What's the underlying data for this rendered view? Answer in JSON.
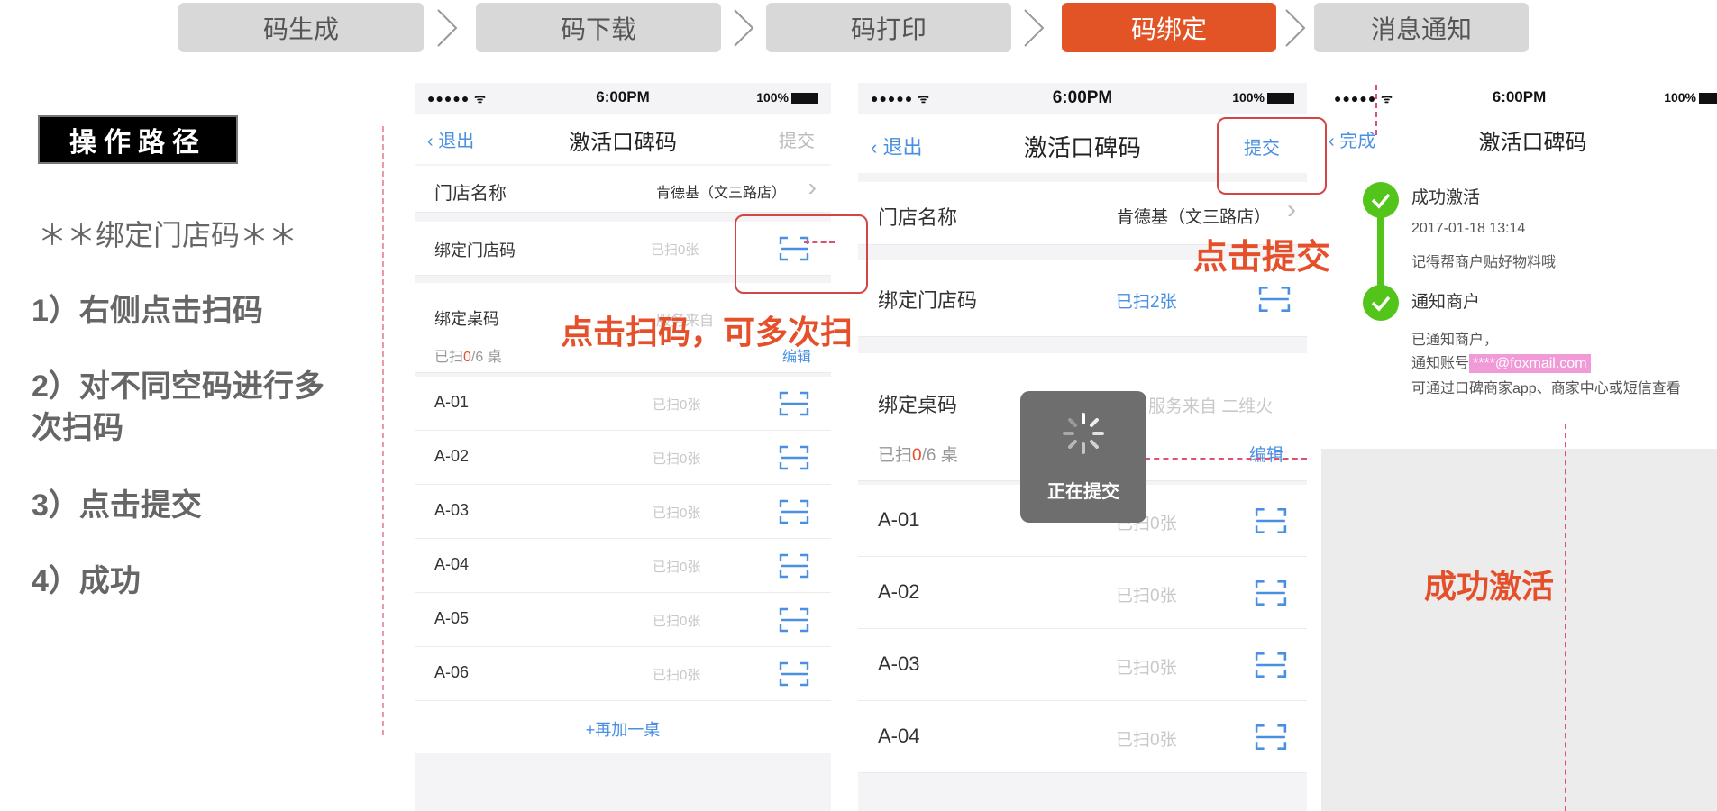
{
  "steps": [
    {
      "label": "码生成",
      "active": false
    },
    {
      "label": "码下载",
      "active": false
    },
    {
      "label": "码打印",
      "active": false
    },
    {
      "label": "码绑定",
      "active": true
    },
    {
      "label": "消息通知",
      "active": false
    }
  ],
  "instructions": {
    "path_title": "操作路径",
    "subtitle": "＊＊绑定门店码＊＊",
    "step1": "1）右侧点击扫码",
    "step2": "2）对不同空码进行多次扫码",
    "step3": "3）点击提交",
    "step4": "4）成功"
  },
  "status_bar": {
    "signal": "●●●●● ᯤ",
    "time": "6:00PM",
    "battery": "100%"
  },
  "phone1": {
    "back": "退出",
    "title": "激活口碑码",
    "submit": "提交",
    "store_label": "门店名称",
    "store_value": "肯德基（文三路店）",
    "bind_store_label": "绑定门店码",
    "bind_store_value": "已扫0张",
    "bind_table_label": "绑定桌码",
    "bind_table_hint": "服务来自",
    "scanned_prefix": "已扫",
    "scanned_count": "0",
    "scanned_suffix": "/6 桌",
    "edit": "编辑",
    "tables": [
      {
        "name": "A-01",
        "value": "已扫0张"
      },
      {
        "name": "A-02",
        "value": "已扫0张"
      },
      {
        "name": "A-03",
        "value": "已扫0张"
      },
      {
        "name": "A-04",
        "value": "已扫0张"
      },
      {
        "name": "A-05",
        "value": "已扫0张"
      },
      {
        "name": "A-06",
        "value": "已扫0张"
      }
    ],
    "add_table": "+再加一桌"
  },
  "phone2": {
    "back": "退出",
    "title": "激活口碑码",
    "submit": "提交",
    "store_label": "门店名称",
    "store_value": "肯德基（文三路店）",
    "bind_store_label": "绑定门店码",
    "bind_store_value": "已扫2张",
    "bind_table_label": "绑定桌码",
    "bind_table_hint": "服务来自 二维火",
    "scanned_prefix": "已扫",
    "scanned_count": "0",
    "scanned_suffix": "/6 桌",
    "edit": "编辑",
    "tables": [
      {
        "name": "A-01",
        "value": "已扫0张"
      },
      {
        "name": "A-02",
        "value": "已扫0张"
      },
      {
        "name": "A-03",
        "value": "已扫0张"
      },
      {
        "name": "A-04",
        "value": "已扫0张"
      }
    ],
    "toast": "正在提交"
  },
  "phone3": {
    "back": "完成",
    "title": "激活口碑码",
    "event1_title": "成功激活",
    "event1_time": "2017-01-18 13:14",
    "event1_note": "记得帮商户贴好物料哦",
    "event2_title": "通知商户",
    "event2_line1": "已通知商户，",
    "event2_line2_prefix": "通知账号",
    "event2_account": "****@foxmail.com",
    "event2_line3": "可通过口碑商家app、商家中心或短信查看"
  },
  "annotations": {
    "scan_hint": "点击扫码，可多次扫",
    "submit_hint": "点击提交",
    "success_hint": "成功激活"
  },
  "colors": {
    "accent": "#e25425",
    "link": "#4a90e2",
    "success": "#52c41a",
    "annotation": "#e5502a"
  }
}
